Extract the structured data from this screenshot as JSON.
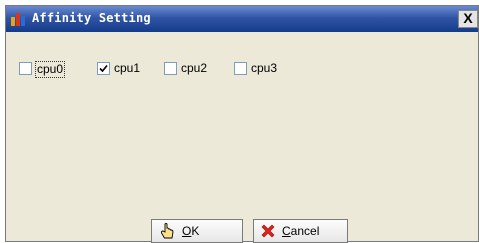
{
  "window": {
    "title": "Affinity Setting",
    "close_glyph": "X",
    "icon": "app-icon"
  },
  "cpus": [
    {
      "label": "cpu0",
      "checked": false,
      "focused": true
    },
    {
      "label": "cpu1",
      "checked": true,
      "focused": false
    },
    {
      "label": "cpu2",
      "checked": false,
      "focused": false
    },
    {
      "label": "cpu3",
      "checked": false,
      "focused": false
    }
  ],
  "buttons": {
    "ok": {
      "mnemonic": "O",
      "rest": "K",
      "icon": "hand-pointer-icon"
    },
    "cancel": {
      "mnemonic": "C",
      "rest": "ancel",
      "icon": "red-x-icon"
    }
  },
  "colors": {
    "title_bar": "#143a8a",
    "dialog_bg": "#ece9d8",
    "checkbox_border": "#7f9db9"
  }
}
